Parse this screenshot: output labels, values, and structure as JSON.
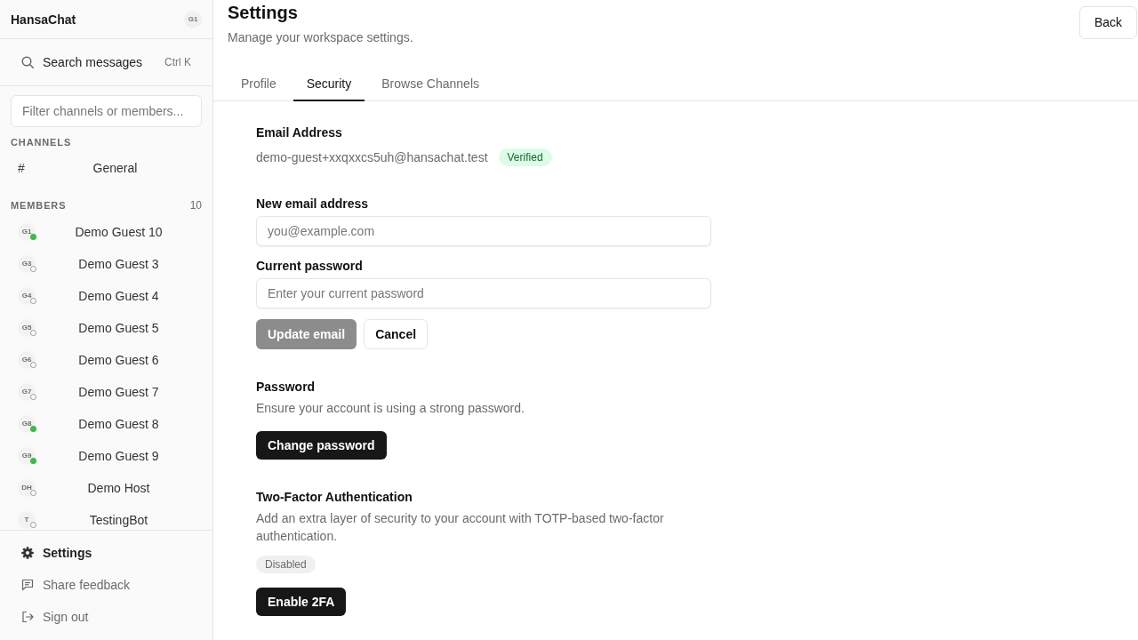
{
  "sidebar": {
    "workspace": "HansaChat",
    "user_initials": "G1",
    "search": {
      "label": "Search messages",
      "shortcut": "Ctrl K"
    },
    "filter": {
      "placeholder": "Filter channels or members..."
    },
    "channels_heading": "CHANNELS",
    "channels": [
      {
        "symbol": "#",
        "name": "General"
      }
    ],
    "members_heading": "MEMBERS",
    "members_count": "10",
    "members": [
      {
        "initials": "G1",
        "name": "Demo Guest 10",
        "online": true
      },
      {
        "initials": "G3",
        "name": "Demo Guest 3",
        "online": false
      },
      {
        "initials": "G4",
        "name": "Demo Guest 4",
        "online": false
      },
      {
        "initials": "G5",
        "name": "Demo Guest 5",
        "online": false
      },
      {
        "initials": "G6",
        "name": "Demo Guest 6",
        "online": false
      },
      {
        "initials": "G7",
        "name": "Demo Guest 7",
        "online": false
      },
      {
        "initials": "G8",
        "name": "Demo Guest 8",
        "online": true
      },
      {
        "initials": "G9",
        "name": "Demo Guest 9",
        "online": true
      },
      {
        "initials": "DH",
        "name": "Demo Host",
        "online": false
      },
      {
        "initials": "T",
        "name": "TestingBot",
        "online": false
      }
    ],
    "footer_items": [
      {
        "kind": "settings",
        "label": "Settings",
        "selected": true
      },
      {
        "kind": "feedback",
        "label": "Share feedback",
        "selected": false
      },
      {
        "kind": "sign_out",
        "label": "Sign out",
        "selected": false
      }
    ]
  },
  "header": {
    "title": "Settings",
    "subtitle": "Manage your workspace settings.",
    "back_button": "Back"
  },
  "tabs": [
    {
      "label": "Profile",
      "selected": false
    },
    {
      "label": "Security",
      "selected": true
    },
    {
      "label": "Browse Channels",
      "selected": false
    }
  ],
  "sections": [
    {
      "title": "Email Address",
      "value": "demo-guest+xxqxxcs5uh@hansachat.test",
      "status": {
        "label": "Verified",
        "kind": "success"
      },
      "fields": [
        {
          "label": "New email address",
          "placeholder": "you@example.com"
        },
        {
          "label": "Current password",
          "placeholder": "Enter your current password"
        }
      ],
      "buttons": [
        {
          "label": "Update email",
          "kind": "primary",
          "disabled": true
        },
        {
          "label": "Cancel",
          "kind": "outline",
          "disabled": false
        }
      ]
    },
    {
      "title": "Password",
      "description": "Ensure your account is using a strong password.",
      "buttons": [
        {
          "label": "Change password",
          "kind": "primary",
          "disabled": false
        }
      ]
    },
    {
      "title": "Two-Factor Authentication",
      "description": "Add an extra layer of security to your account with TOTP-based two-factor authentication.",
      "status": {
        "label": "Disabled",
        "kind": "neutral"
      },
      "buttons": [
        {
          "label": "Enable 2FA",
          "kind": "primary",
          "disabled": false
        }
      ]
    }
  ]
}
